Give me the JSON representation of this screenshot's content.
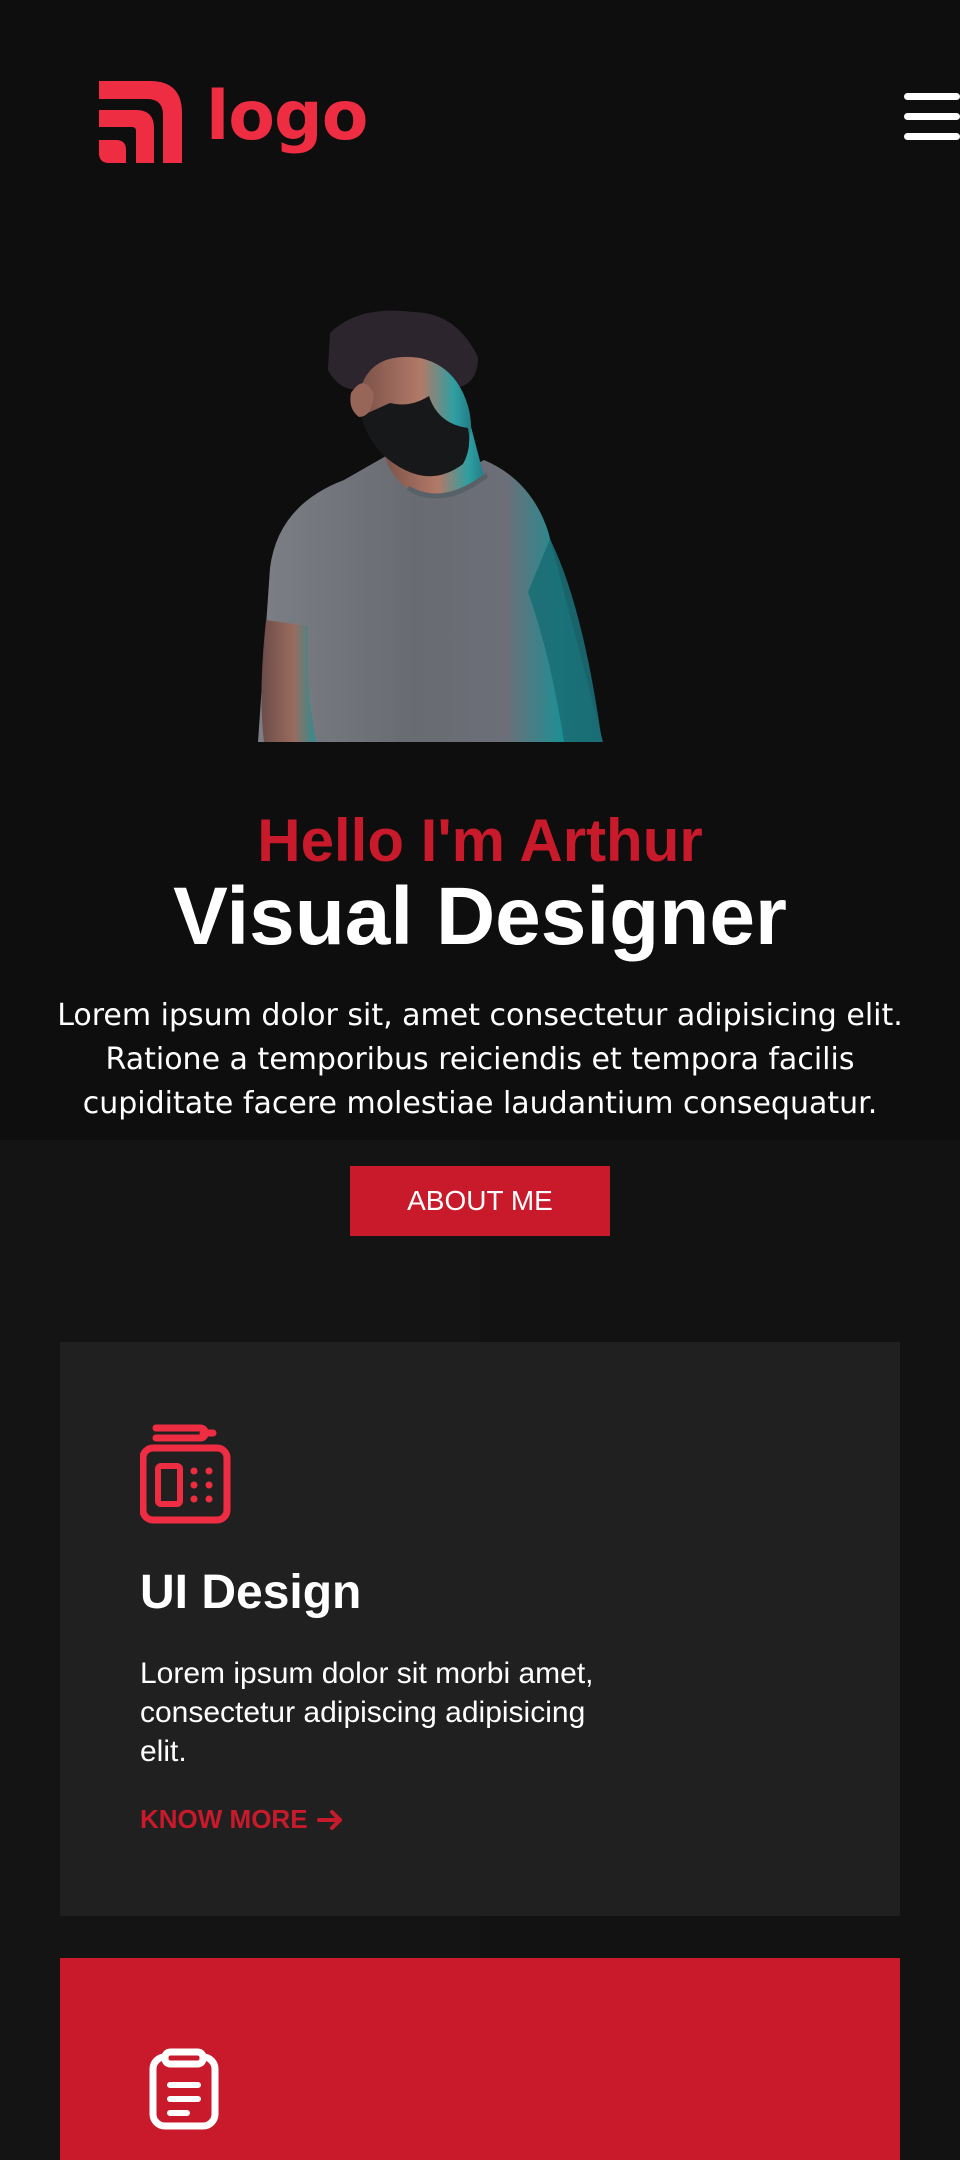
{
  "brand": {
    "logo_text": "logo",
    "accent": "#ef2d42",
    "primary": "#c91a2b",
    "background": "#0e0e0e"
  },
  "header": {
    "menu_icon": "hamburger-menu-icon"
  },
  "hero": {
    "greeting": "Hello I'm Arthur",
    "role": "Visual Designer",
    "description": "Lorem ipsum dolor sit, amet consectetur adipisicing elit. Ratione a temporibus reiciendis et tempora facilis cupiditate facere molestiae laudantium consequatur.",
    "button_label": "ABOUT ME",
    "image_icon": "portrait-photo"
  },
  "services": [
    {
      "icon": "ui-design-icon",
      "title": "UI Design",
      "description": "Lorem ipsum dolor sit morbi amet, consectetur adipiscing adipisicing elit.",
      "link_label": "KNOW MORE",
      "link_icon": "arrow-right-icon",
      "background": "#202020"
    },
    {
      "icon": "clipboard-icon",
      "background": "#c91a2b"
    }
  ]
}
